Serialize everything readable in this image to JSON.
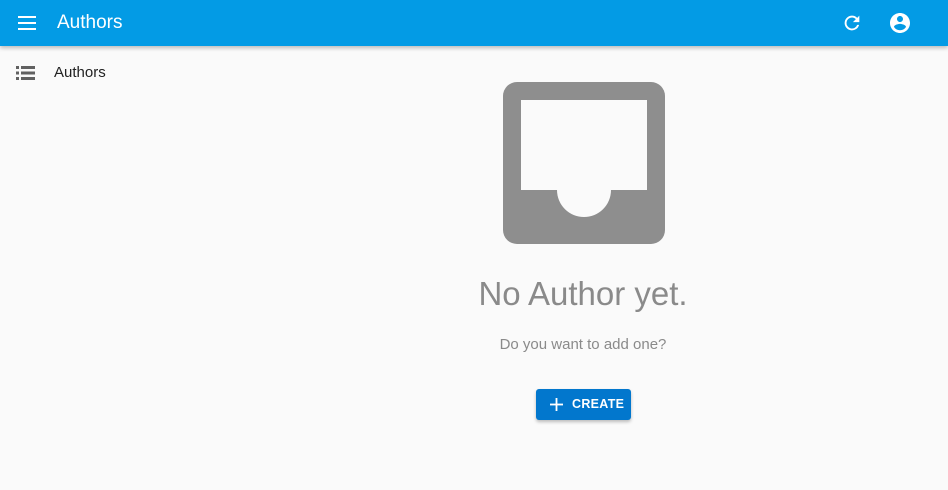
{
  "appbar": {
    "title": "Authors",
    "icons": {
      "menu": "hamburger-menu-icon",
      "refresh": "refresh-icon",
      "account": "account-circle-icon"
    }
  },
  "sidebar": {
    "items": [
      {
        "label": "Authors",
        "icon": "list-icon"
      }
    ]
  },
  "empty_state": {
    "icon": "inbox-icon",
    "title": "No Author yet.",
    "subtitle": "Do you want to add one?",
    "create_label": "CREATE"
  },
  "colors": {
    "appbar": "#039be5",
    "primary_button": "#0277cd",
    "empty_text": "#8a8a8a",
    "background": "#fafafa"
  }
}
